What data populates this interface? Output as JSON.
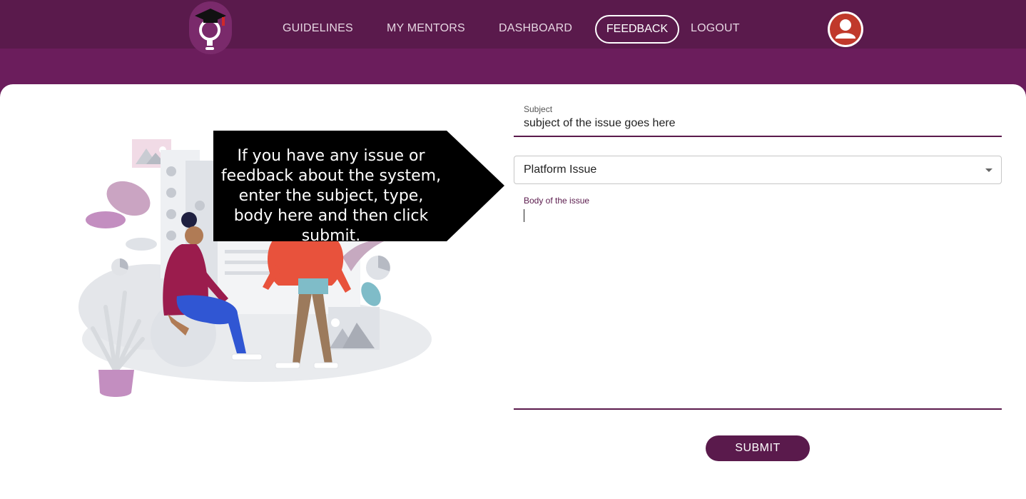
{
  "nav": {
    "items": [
      {
        "label": "GUIDELINES"
      },
      {
        "label": "MY MENTORS"
      },
      {
        "label": "DASHBOARD"
      },
      {
        "label": "FEEDBACK"
      },
      {
        "label": "LOGOUT"
      }
    ],
    "active": "FEEDBACK"
  },
  "logo": {
    "icon": "graduation-cap-lightbulb-icon"
  },
  "profile": {
    "icon": "user-avatar-icon"
  },
  "callout": {
    "text": "If you have any issue or feedback about the system, enter the subject, type, body here and then click submit."
  },
  "form": {
    "subject_label": "Subject",
    "subject_value": "subject of the issue goes here",
    "type_value": "Platform Issue",
    "body_label": "Body of the issue",
    "body_value": "",
    "submit_label": "SUBMIT"
  },
  "colors": {
    "brand_dark": "#5a1a4c",
    "brand": "#6b1d5c",
    "avatar_red": "#c0392b"
  }
}
